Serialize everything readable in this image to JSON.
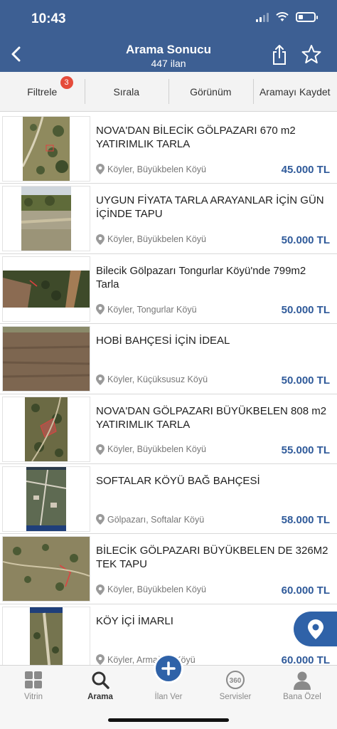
{
  "status_bar": {
    "time": "10:43"
  },
  "header": {
    "title": "Arama Sonucu",
    "subtitle": "447 ilan",
    "icons": [
      "chevron-left-icon",
      "share-icon",
      "star-icon"
    ]
  },
  "toolbar": {
    "filter_label": "Filtrele",
    "filter_badge": "3",
    "sort_label": "Sırala",
    "view_label": "Görünüm",
    "save_search_label": "Aramayı Kaydet"
  },
  "listings": [
    {
      "title": "NOVA'DAN BİLECİK GÖLPAZARI 670 m2 YATIRIMLIK TARLA",
      "location": "Köyler, Büyükbelen Köyü",
      "price": "45.000 TL"
    },
    {
      "title": "UYGUN FİYATA TARLA ARAYANLAR İÇİN GÜN İÇİNDE TAPU",
      "location": "Köyler, Büyükbelen Köyü",
      "price": "50.000 TL"
    },
    {
      "title": "Bilecik Gölpazarı Tongurlar Köyü'nde 799m2 Tarla",
      "location": "Köyler, Tongurlar Köyü",
      "price": "50.000 TL"
    },
    {
      "title": "HOBİ BAHÇESİ İÇİN İDEAL",
      "location": "Köyler, Küçüksusuz Köyü",
      "price": "50.000 TL"
    },
    {
      "title": "NOVA'DAN GÖLPAZARI BÜYÜKBELEN 808 m2 YATIRIMLIK TARLA",
      "location": "Köyler, Büyükbelen Köyü",
      "price": "55.000 TL"
    },
    {
      "title": "SOFTALAR KÖYÜ BAĞ BAHÇESİ",
      "location": "Gölpazarı, Softalar Köyü",
      "price": "58.000 TL"
    },
    {
      "title": "BİLECİK GÖLPAZARI BÜYÜKBELEN DE 326M2 TEK TAPU",
      "location": "Köyler, Büyükbelen Köyü",
      "price": "60.000 TL"
    },
    {
      "title": "KÖY İÇİ İMARLI",
      "location": "Köyler, Armağan Köyü",
      "price": "60.000 TL"
    }
  ],
  "tabbar": {
    "tabs": [
      {
        "label": "Vitrin",
        "icon": "grid-icon"
      },
      {
        "label": "Arama",
        "icon": "search-icon"
      },
      {
        "label": "İlan Ver",
        "icon": "plus-icon"
      },
      {
        "label": "Servisler",
        "icon": "360-icon"
      },
      {
        "label": "Bana Özel",
        "icon": "person-icon"
      }
    ],
    "active": "Arama"
  },
  "colors": {
    "header": "#3d5f93",
    "price": "#2f5a9a",
    "accent": "#2f62a8",
    "badge": "#e54b3a"
  }
}
